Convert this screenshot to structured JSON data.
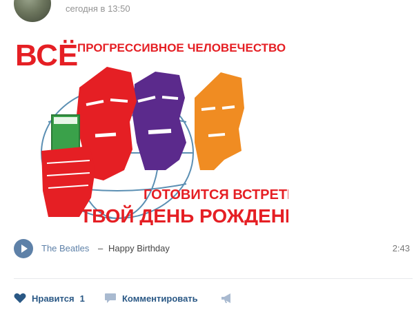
{
  "post": {
    "timestamp": "сегодня в 13:50"
  },
  "poster": {
    "headline_big": "ВСЁ",
    "headline_small": "ПРОГРЕССИВНОЕ ЧЕЛОВЕЧЕСТВО",
    "line2": "ГОТОВИТСЯ ВСТРЕТИТЬ",
    "line3": "ТВОЙ ДЕНЬ РОЖДЕНИЯ!"
  },
  "audio": {
    "artist": "The Beatles",
    "separator": "–",
    "title": "Happy Birthday",
    "duration": "2:43"
  },
  "actions": {
    "like_label": "Нравится",
    "like_count": "1",
    "comment_label": "Комментировать"
  },
  "colors": {
    "accent": "#5e81a8",
    "link": "#2a5885",
    "poster_red": "#e51f24",
    "poster_purple": "#5b2a8c",
    "poster_orange": "#f08c22",
    "poster_green": "#3aa14a"
  }
}
